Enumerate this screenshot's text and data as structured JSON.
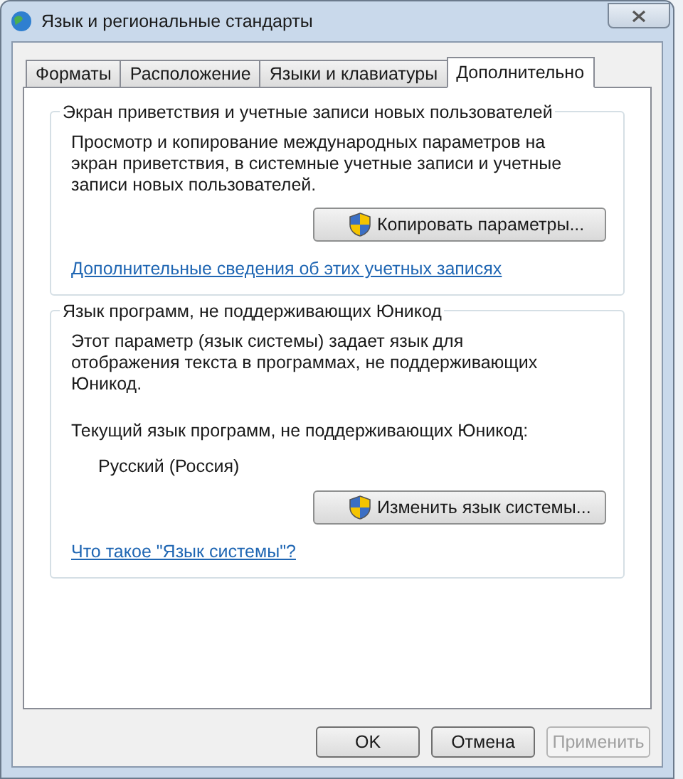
{
  "window": {
    "title": "Язык и региональные стандарты"
  },
  "tabs": [
    {
      "label": "Форматы",
      "selected": false
    },
    {
      "label": "Расположение",
      "selected": false
    },
    {
      "label": "Языки и клавиатуры",
      "selected": false
    },
    {
      "label": "Дополнительно",
      "selected": true
    }
  ],
  "groups": [
    {
      "title": "Экран приветствия и учетные записи новых пользователей",
      "description": "Просмотр и копирование международных параметров на экран приветствия, в системные учетные записи и учетные записи новых пользователей.",
      "button": "Копировать параметры...",
      "link": "Дополнительные сведения об этих учетных записях"
    },
    {
      "title": "Язык программ, не поддерживающих Юникод",
      "description": "Этот параметр (язык системы) задает язык для отображения текста в программах, не поддерживающих Юникод.",
      "current_label": "Текущий язык программ, не поддерживающих Юникод:",
      "current_value": "Русский (Россия)",
      "button": "Изменить язык системы...",
      "link": "Что такое \"Язык системы\"?"
    }
  ],
  "buttons": [
    {
      "label": "OK",
      "disabled": false
    },
    {
      "label": "Отмена",
      "disabled": false
    },
    {
      "label": "Применить",
      "disabled": true
    }
  ]
}
